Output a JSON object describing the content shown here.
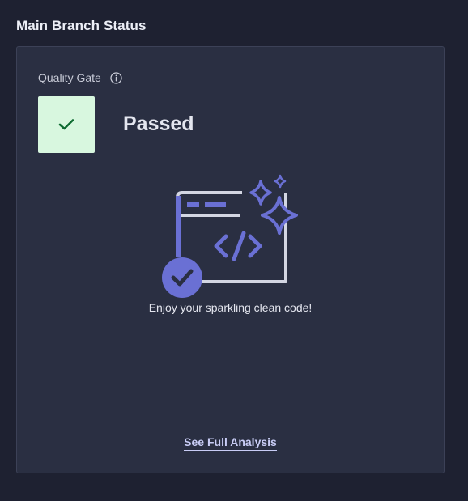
{
  "header": {
    "title": "Main Branch Status"
  },
  "quality_gate": {
    "label": "Quality Gate",
    "info_icon": "info-icon",
    "status": "Passed",
    "status_icon": "check-icon",
    "status_color": "#d8f7df",
    "check_color": "#0e6b31"
  },
  "illustration": {
    "name": "sparkling-code-illustration",
    "accent": "#6a70d4",
    "frame": "#d3d6e2",
    "message": "Enjoy your sparkling clean code!"
  },
  "actions": {
    "full_analysis_label": "See Full Analysis"
  }
}
